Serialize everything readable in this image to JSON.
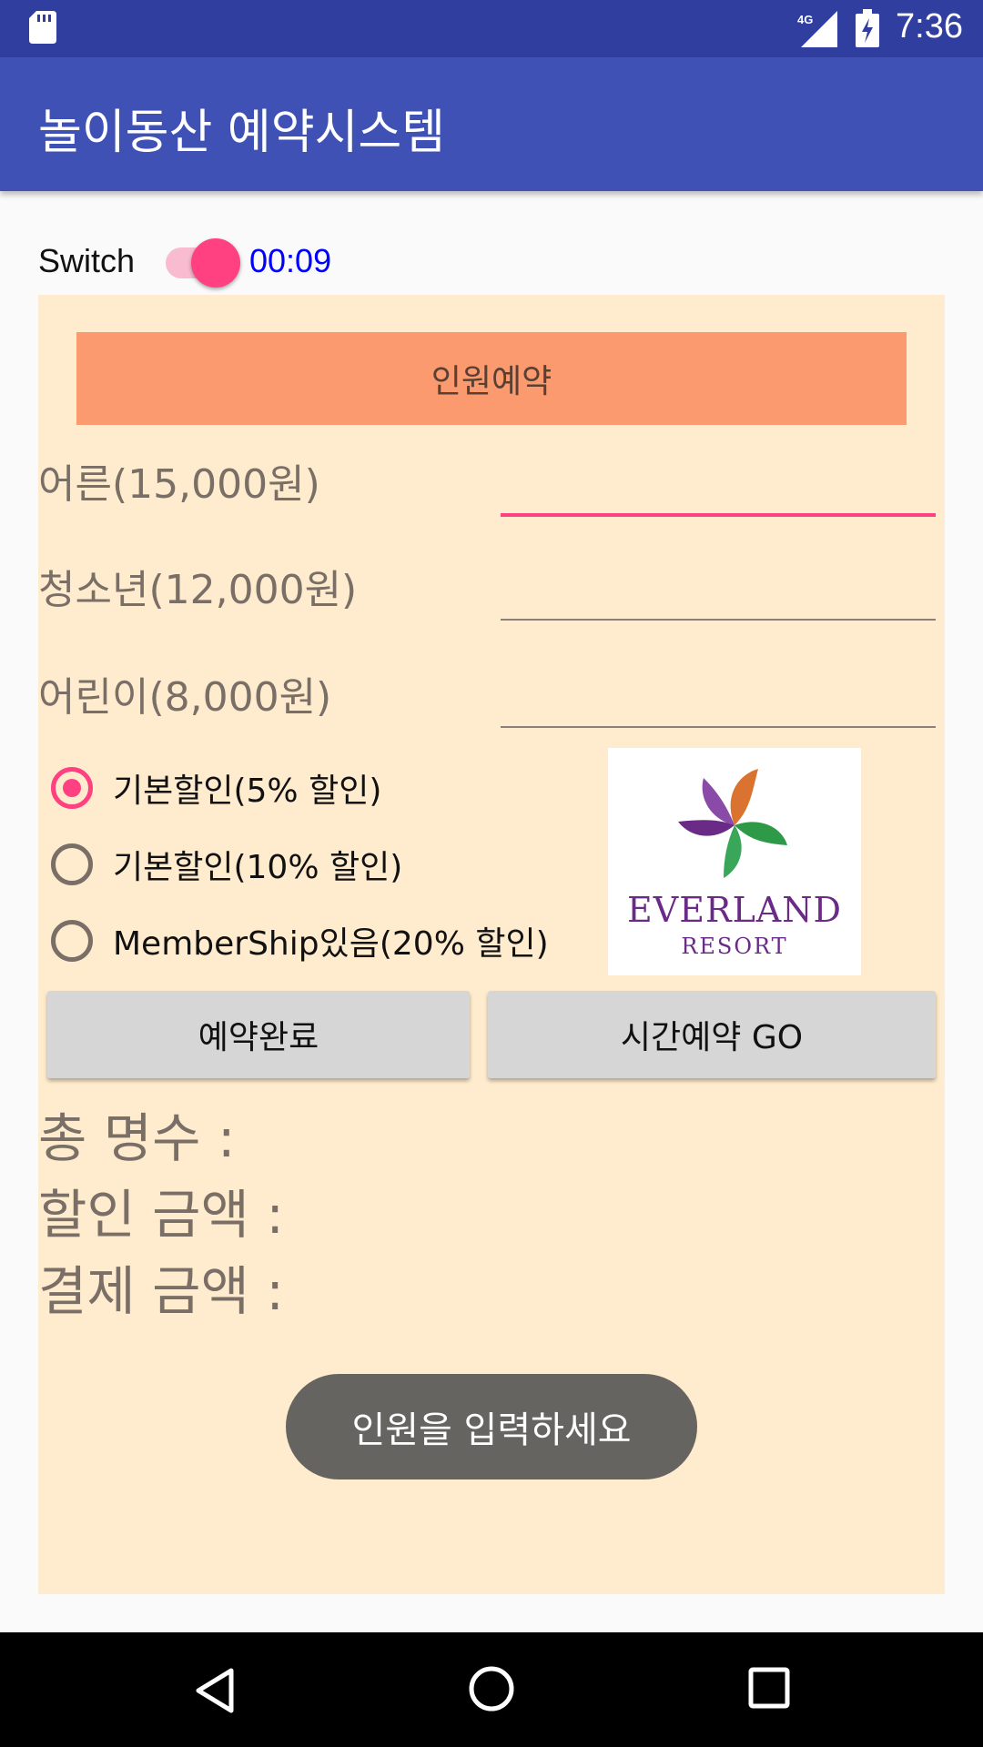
{
  "status_bar": {
    "time": "7:36",
    "network": "4G",
    "icons": [
      "sd-card-icon",
      "signal-icon",
      "battery-charging-icon"
    ]
  },
  "app_bar": {
    "title": "놀이동산 예약시스템"
  },
  "switch": {
    "label": "Switch",
    "checked": true,
    "chronometer": "00:09"
  },
  "panel": {
    "header_button": "인원예약",
    "fields": [
      {
        "label": "어른(15,000원)",
        "value": ""
      },
      {
        "label": "청소년(12,000원)",
        "value": ""
      },
      {
        "label": "어린이(8,000원)",
        "value": ""
      }
    ],
    "discounts": [
      {
        "label": "기본할인(5% 할인)",
        "checked": true
      },
      {
        "label": "기본할인(10% 할인)",
        "checked": false
      },
      {
        "label": "MemberShip있음(20% 할인)",
        "checked": false
      }
    ],
    "logo": {
      "line1": "EVERLAND",
      "line2": "RESORT"
    },
    "buttons": {
      "complete": "예약완료",
      "time_go": "시간예약 GO"
    },
    "results": {
      "total_people": "총 명수 :",
      "discount_amount": "할인 금액 :",
      "payment_amount": "결제 금액 :"
    }
  },
  "toast": {
    "message": "인원을 입력하세요"
  },
  "colors": {
    "primary": "#3f51b5",
    "primary_dark": "#303f9f",
    "accent": "#ff4081",
    "panel_bg": "#ffebcd",
    "header_button_bg": "#fa9a6e",
    "chronometer": "#0000ff"
  },
  "nav_bar": {
    "icons": [
      "back-icon",
      "home-icon",
      "recents-icon"
    ]
  }
}
